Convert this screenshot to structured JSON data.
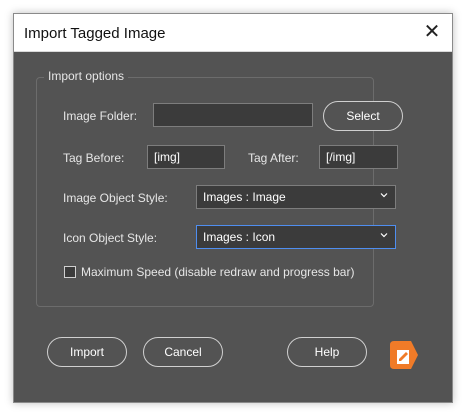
{
  "dialog": {
    "title": "Import Tagged Image",
    "close_icon": "close-icon"
  },
  "options": {
    "legend": "Import options",
    "image_folder": {
      "label": "Image Folder:",
      "value": "",
      "button": "Select"
    },
    "tag_before": {
      "label": "Tag Before:",
      "value": "[img]"
    },
    "tag_after": {
      "label": "Tag After:",
      "value": "[/img]"
    },
    "image_object_style": {
      "label": "Image Object Style:",
      "value": "Images : Image"
    },
    "icon_object_style": {
      "label": "Icon Object Style:",
      "value": "Images : Icon"
    },
    "max_speed": {
      "label": "Maximum Speed (disable redraw and progress bar)",
      "checked": false
    }
  },
  "buttons": {
    "import": "Import",
    "cancel": "Cancel",
    "help": "Help"
  },
  "colors": {
    "dialog_bg": "#535353",
    "focus_border": "#4f8ef0",
    "logo_orange": "#f07b28"
  }
}
